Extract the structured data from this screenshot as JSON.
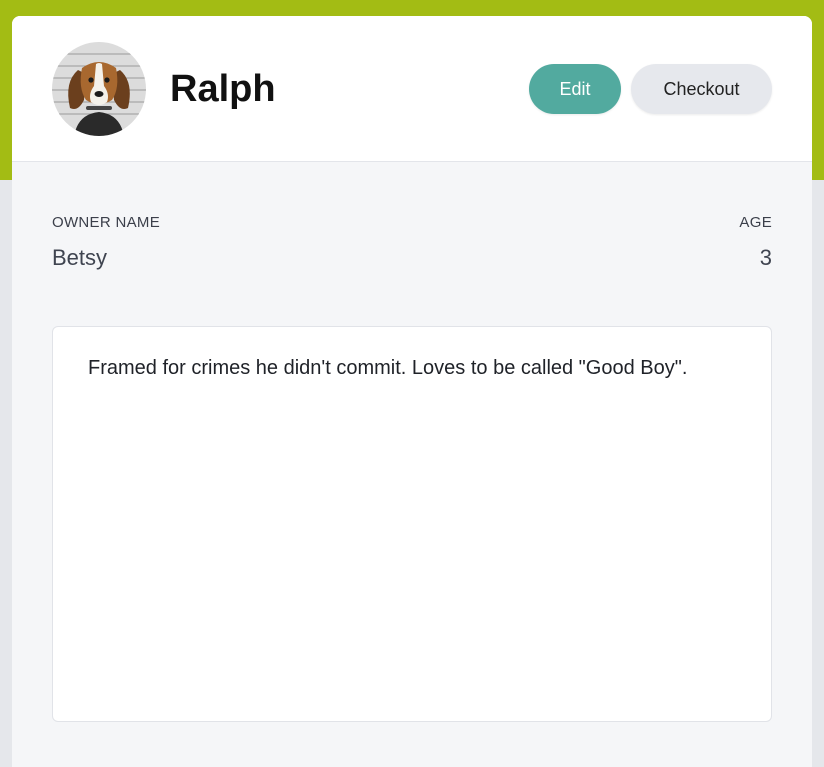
{
  "pet": {
    "name": "Ralph",
    "avatar_icon": "beagle-mugshot-photo"
  },
  "actions": {
    "edit_label": "Edit",
    "checkout_label": "Checkout"
  },
  "details": {
    "owner_label": "OWNER NAME",
    "owner_value": "Betsy",
    "age_label": "AGE",
    "age_value": "3"
  },
  "bio": {
    "text": "Framed for crimes he didn't commit. Loves to be called \"Good Boy\"."
  },
  "colors": {
    "accent": "#a3bc14",
    "edit_button": "#52aa9f",
    "checkout_button": "#e6e8ed"
  }
}
